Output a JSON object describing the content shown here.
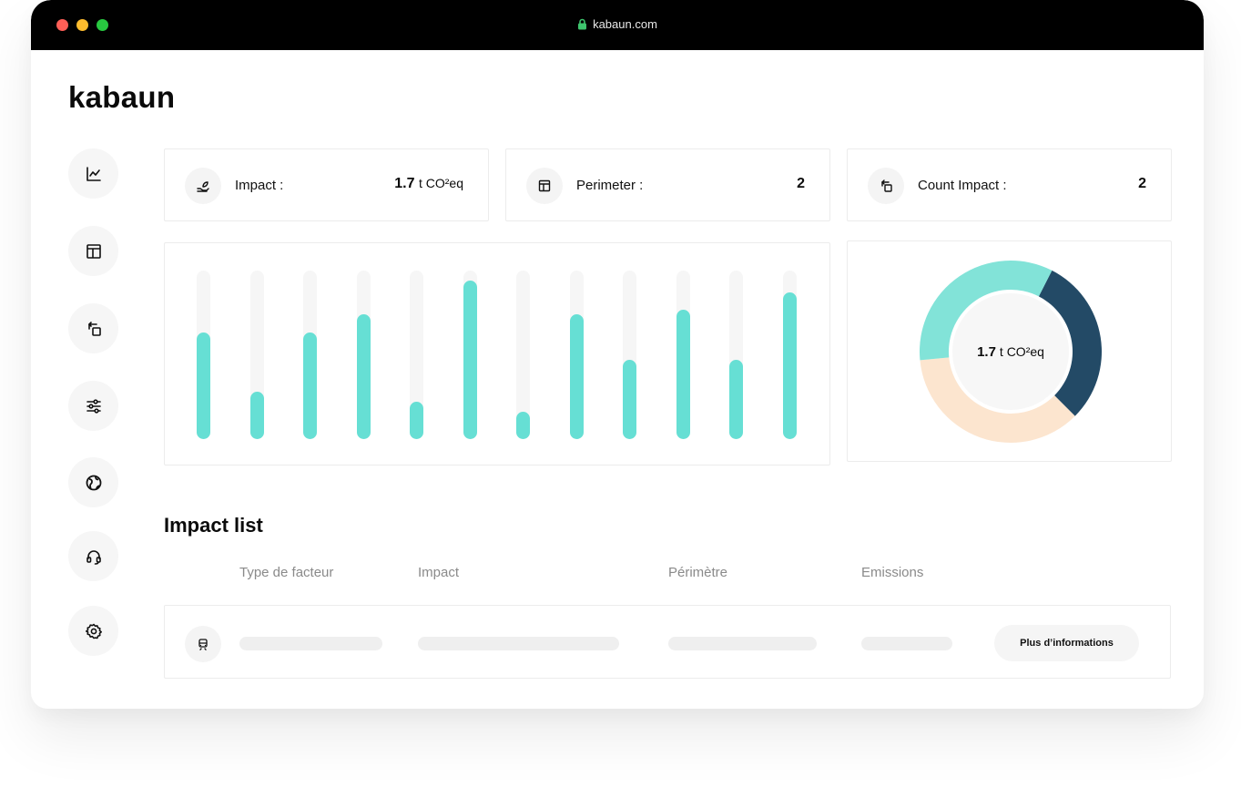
{
  "browser": {
    "url": "kabaun.com"
  },
  "app": {
    "logo": "kabaun"
  },
  "sidebar": {
    "items": [
      {
        "name": "analytics",
        "icon": "line-chart-icon"
      },
      {
        "name": "perimeter",
        "icon": "layout-icon"
      },
      {
        "name": "count-impact",
        "icon": "transfer-icon"
      },
      {
        "name": "filters",
        "icon": "sliders-icon"
      },
      {
        "name": "globe",
        "icon": "globe-icon"
      },
      {
        "name": "support",
        "icon": "headset-icon"
      },
      {
        "name": "settings",
        "icon": "gear-icon"
      }
    ]
  },
  "stats": {
    "impact": {
      "label": "Impact :",
      "value": "1.7",
      "unit": "t CO²eq",
      "icon": "hand-leaf-icon"
    },
    "perimeter": {
      "label": "Perimeter :",
      "value": "2",
      "icon": "layout-icon"
    },
    "count_impact": {
      "label": "Count Impact :",
      "value": "2",
      "icon": "transfer-icon"
    }
  },
  "chart_data": [
    {
      "type": "bar",
      "values": [
        63,
        28,
        63,
        74,
        22,
        94,
        16,
        74,
        47,
        77,
        47,
        87
      ],
      "ylim": [
        0,
        100
      ],
      "grid": false,
      "colors": {
        "bar": "#66dfd4",
        "track": "#f6f6f6"
      }
    },
    {
      "type": "pie",
      "values": [
        30,
        36,
        34
      ],
      "colors": [
        "#234a66",
        "#fce5cf",
        "#82e3d8"
      ],
      "center_value": "1.7",
      "center_unit": "t CO²eq"
    }
  ],
  "impact_list": {
    "title": "Impact list",
    "columns": [
      "Type de facteur",
      "Impact",
      "Périmètre",
      "Emissions"
    ],
    "rows": [
      {
        "icon": "train-icon",
        "button_label": "Plus d’informations"
      }
    ]
  }
}
